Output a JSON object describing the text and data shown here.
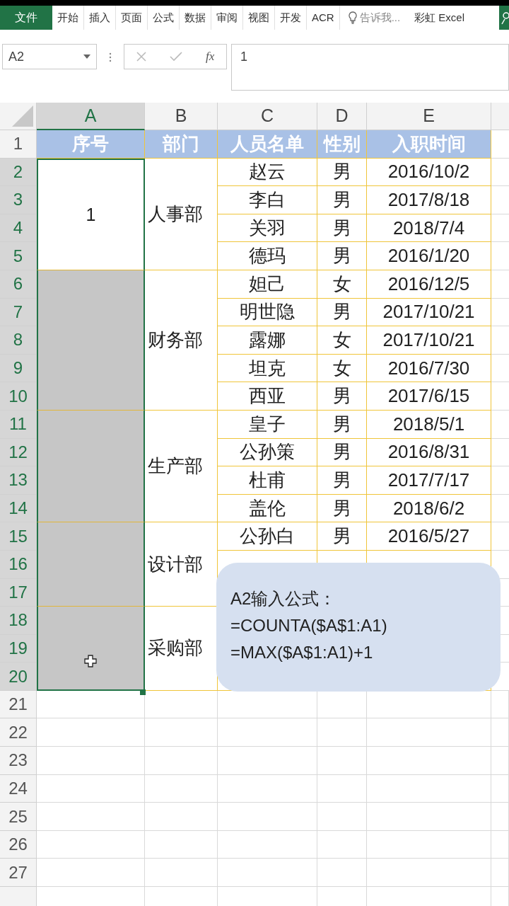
{
  "ribbon": {
    "tabs": [
      {
        "label": "文件",
        "kind": "file",
        "selected": false
      },
      {
        "label": "开始",
        "kind": "tab",
        "selected": false
      },
      {
        "label": "插入",
        "kind": "tab",
        "selected": false
      },
      {
        "label": "页面",
        "kind": "tab",
        "selected": false
      },
      {
        "label": "公式",
        "kind": "tab",
        "selected": false
      },
      {
        "label": "数据",
        "kind": "tab",
        "selected": false
      },
      {
        "label": "审阅",
        "kind": "tab",
        "selected": false
      },
      {
        "label": "视图",
        "kind": "tab",
        "selected": false
      },
      {
        "label": "开发",
        "kind": "tab",
        "selected": false
      },
      {
        "label": "ACR",
        "kind": "tab",
        "selected": false
      }
    ],
    "tell_me": "告诉我...",
    "addin": "彩虹 Excel"
  },
  "formula_bar": {
    "name_box": "A2",
    "fx": "fx",
    "value": "1"
  },
  "columns": [
    {
      "label": "A",
      "selected": true
    },
    {
      "label": "B",
      "selected": false
    },
    {
      "label": "C",
      "selected": false
    },
    {
      "label": "D",
      "selected": false
    },
    {
      "label": "E",
      "selected": false
    }
  ],
  "header_row": {
    "number": "1",
    "selected": false,
    "cells": [
      "序号",
      "部门",
      "人员名单",
      "性别",
      "入职时间"
    ]
  },
  "groups": [
    {
      "seq": "1",
      "active": true,
      "dept": "人事部",
      "rows": [
        {
          "number": "2",
          "selected": true,
          "name": "赵云",
          "gender": "男",
          "date": "2016/10/2"
        },
        {
          "number": "3",
          "selected": true,
          "name": "李白",
          "gender": "男",
          "date": "2017/8/18"
        },
        {
          "number": "4",
          "selected": true,
          "name": "关羽",
          "gender": "男",
          "date": "2018/7/4"
        },
        {
          "number": "5",
          "selected": true,
          "name": "德玛",
          "gender": "男",
          "date": "2016/1/20"
        }
      ]
    },
    {
      "active": false,
      "dept": "财务部",
      "rows": [
        {
          "number": "6",
          "selected": true,
          "name": "妲己",
          "gender": "女",
          "date": "2016/12/5"
        },
        {
          "number": "7",
          "selected": true,
          "name": "明世隐",
          "gender": "男",
          "date": "2017/10/21"
        },
        {
          "number": "8",
          "selected": true,
          "name": "露娜",
          "gender": "女",
          "date": "2017/10/21"
        },
        {
          "number": "9",
          "selected": true,
          "name": "坦克",
          "gender": "女",
          "date": "2016/7/30"
        },
        {
          "number": "10",
          "selected": true,
          "name": "西亚",
          "gender": "男",
          "date": "2017/6/15"
        }
      ]
    },
    {
      "active": false,
      "dept": "生产部",
      "rows": [
        {
          "number": "11",
          "selected": true,
          "name": "皇子",
          "gender": "男",
          "date": "2018/5/1"
        },
        {
          "number": "12",
          "selected": true,
          "name": "公孙策",
          "gender": "男",
          "date": "2016/8/31"
        },
        {
          "number": "13",
          "selected": true,
          "name": "杜甫",
          "gender": "男",
          "date": "2017/7/17"
        },
        {
          "number": "14",
          "selected": true,
          "name": "盖伦",
          "gender": "男",
          "date": "2018/6/2"
        }
      ]
    },
    {
      "active": false,
      "dept": "设计部",
      "rows": [
        {
          "number": "15",
          "selected": true,
          "name": "公孙白",
          "gender": "男",
          "date": "2016/5/27"
        },
        {
          "number": "16",
          "selected": true
        },
        {
          "number": "17",
          "selected": true
        }
      ]
    },
    {
      "active": false,
      "dept": "采购部",
      "rows": [
        {
          "number": "18",
          "selected": true
        },
        {
          "number": "19",
          "selected": true
        },
        {
          "number": "20",
          "selected": true
        }
      ]
    }
  ],
  "empty_rows": [
    {
      "number": "21",
      "selected": false
    },
    {
      "number": "22",
      "selected": false
    },
    {
      "number": "23",
      "selected": false
    },
    {
      "number": "24",
      "selected": false
    },
    {
      "number": "25",
      "selected": false
    },
    {
      "number": "26",
      "selected": false
    },
    {
      "number": "27",
      "selected": false
    }
  ],
  "note": {
    "lines": [
      "A2输入公式：",
      "=COUNTA($A$1:A1)",
      "=MAX($A$1:A1)+1"
    ]
  }
}
